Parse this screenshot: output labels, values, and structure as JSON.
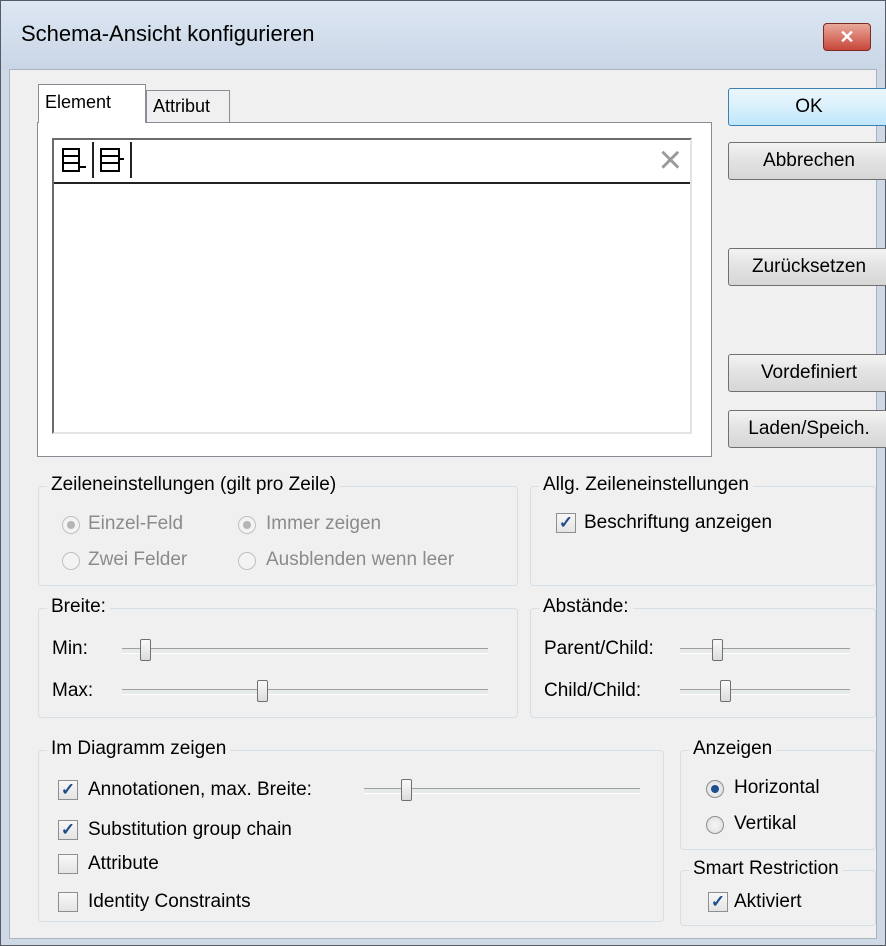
{
  "window": {
    "title": "Schema-Ansicht konfigurieren",
    "close_glyph": "✕"
  },
  "tabs": [
    {
      "label": "Element",
      "active": true
    },
    {
      "label": "Attribut",
      "active": false
    }
  ],
  "list": {
    "toolbar_icons": [
      "append-row-icon",
      "insert-row-icon"
    ],
    "delete_icon": "×"
  },
  "buttons": {
    "ok": "OK",
    "cancel": "Abbrechen",
    "reset": "Zurücksetzen",
    "predefined": "Vordefiniert",
    "load_save": "Laden/Speich."
  },
  "zeileneinstellungen": {
    "title": "Zeileneinstellungen (gilt pro Zeile)",
    "einzel_feld": {
      "label": "Einzel-Feld",
      "selected": true
    },
    "zwei_felder": {
      "label": "Zwei Felder",
      "selected": false
    },
    "immer_zeigen": {
      "label": "Immer zeigen",
      "selected": true
    },
    "ausblenden": {
      "label": "Ausblenden wenn leer",
      "selected": false
    }
  },
  "allg": {
    "title": "Allg. Zeileneinstellungen",
    "beschriftung": {
      "label": "Beschriftung anzeigen",
      "checked": true
    }
  },
  "breite": {
    "title": "Breite:",
    "min": {
      "label": "Min:",
      "value": 0.05
    },
    "max": {
      "label": "Max:",
      "value": 0.38
    }
  },
  "abstaende": {
    "title": "Abstände:",
    "parent_child": {
      "label": "Parent/Child:",
      "value": 0.2
    },
    "child_child": {
      "label": "Child/Child:",
      "value": 0.25
    }
  },
  "diagramm": {
    "title": "Im Diagramm zeigen",
    "annotationen": {
      "label": "Annotationen, max. Breite:",
      "checked": true,
      "slider_value": 0.14
    },
    "substitution": {
      "label": "Substitution group chain",
      "checked": true
    },
    "attribute": {
      "label": "Attribute",
      "checked": false
    },
    "identity": {
      "label": "Identity Constraints",
      "checked": false
    }
  },
  "anzeigen": {
    "title": "Anzeigen",
    "horizontal": {
      "label": "Horizontal",
      "selected": true
    },
    "vertikal": {
      "label": "Vertikal",
      "selected": false
    }
  },
  "smart": {
    "title": "Smart Restriction",
    "aktiviert": {
      "label": "Aktiviert",
      "checked": true
    }
  },
  "check_glyph": "✓",
  "colors": {
    "title_bg": "#cfd9e6",
    "close_red": "#c8463a",
    "dialog_bg": "#f0f0f0"
  }
}
